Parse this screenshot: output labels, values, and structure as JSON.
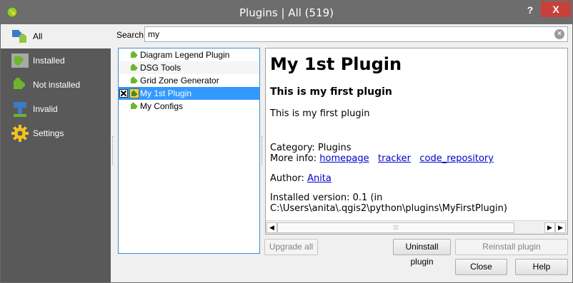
{
  "window": {
    "title": "Plugins | All (519)"
  },
  "sidebar": {
    "items": [
      {
        "label": "All",
        "icon": "puzzle-all-icon",
        "selected": true
      },
      {
        "label": "Installed",
        "icon": "puzzle-installed-icon"
      },
      {
        "label": "Not installed",
        "icon": "puzzle-not-installed-icon"
      },
      {
        "label": "Invalid",
        "icon": "invalid-plugin-icon"
      },
      {
        "label": "Settings",
        "icon": "gear-icon"
      }
    ]
  },
  "search": {
    "label": "Search",
    "value": "my"
  },
  "plugins": [
    {
      "label": "Diagram Legend Plugin"
    },
    {
      "label": "DSG Tools"
    },
    {
      "label": "Grid Zone Generator"
    },
    {
      "label": "My 1st Plugin",
      "selected": true,
      "checked": true
    },
    {
      "label": "My Configs"
    }
  ],
  "details": {
    "title": "My 1st Plugin",
    "subtitle": "This is my first plugin",
    "description": "This is my first plugin",
    "category": "Category: Plugins",
    "more_info_label": "More info:",
    "links": {
      "homepage": "homepage",
      "tracker": "tracker",
      "code_repository": "code_repository"
    },
    "author_label": "Author:",
    "author": "Anita",
    "installed_version_line1": "Installed version: 0.1 (in",
    "installed_version_line2": "C:\\Users\\anita\\.qgis2\\python\\plugins\\MyFirstPlugin)"
  },
  "buttons": {
    "upgrade_all": "Upgrade all",
    "uninstall": "Uninstall plugin",
    "reinstall": "Reinstall plugin",
    "close": "Close",
    "help": "Help"
  },
  "titlebar": {
    "help_glyph": "?",
    "close_glyph": "X"
  },
  "colors": {
    "titlebar": "#6d6d6d",
    "sidebar": "#595959",
    "selection": "#3399ff",
    "link": "#0000cc",
    "close": "#c7413a"
  }
}
